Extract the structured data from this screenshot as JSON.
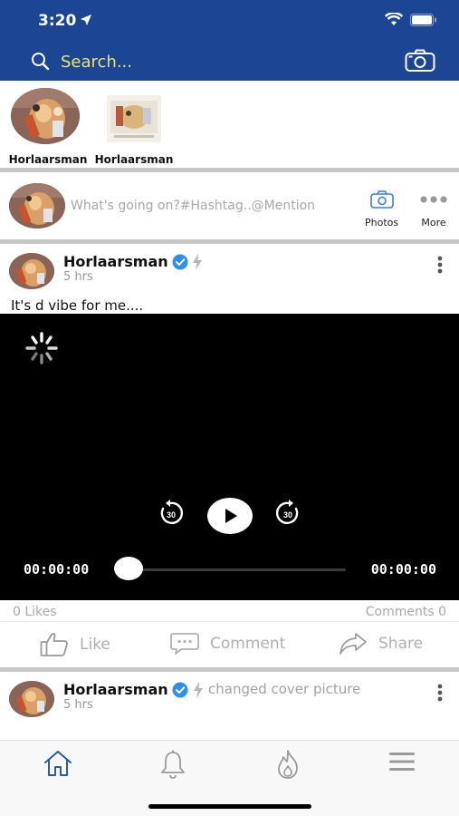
{
  "status_bar": {
    "time": "3:20"
  },
  "header": {
    "search_placeholder": "Search...",
    "accent_color": "#1c4694",
    "search_color": "#e8e56a"
  },
  "stories": [
    {
      "label": "Horlaarsman"
    },
    {
      "label": "Horlaarsman"
    }
  ],
  "composer": {
    "placeholder": "What's going on?#Hashtag..@Mention",
    "photos_label": "Photos",
    "more_label": "More"
  },
  "post": {
    "author": "Horlaarsman",
    "time": "5 hrs",
    "text": "It's d vibe for me....",
    "video": {
      "current_time": "00:00:00",
      "duration": "00:00:00",
      "progress": 0,
      "rewind_seconds": "30",
      "forward_seconds": "30"
    },
    "likes": "0 Likes",
    "comments": "Comments 0",
    "like_label": "Like",
    "comment_label": "Comment",
    "share_label": "Share"
  },
  "post2": {
    "author": "Horlaarsman",
    "action": "changed cover picture",
    "time": "5 hrs"
  },
  "bottom_nav": [
    {
      "icon": "home-icon",
      "active": true
    },
    {
      "icon": "bell-icon",
      "active": false
    },
    {
      "icon": "flame-icon",
      "active": false
    },
    {
      "icon": "menu-icon",
      "active": false
    }
  ]
}
